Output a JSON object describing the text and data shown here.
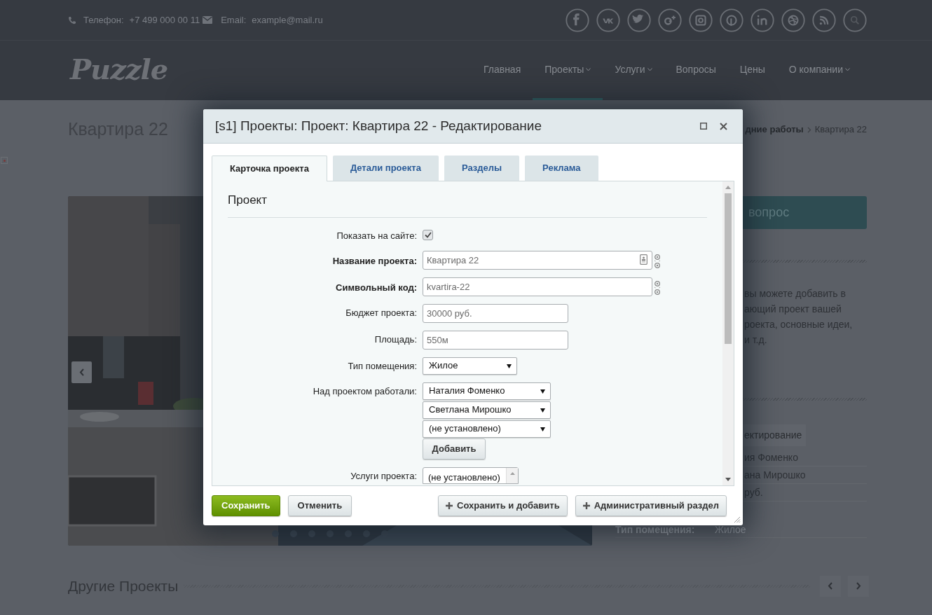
{
  "top_bar": {
    "phone_label": "Телефон:",
    "phone": "+7 499 000 00 11",
    "email_label": "Email:",
    "email": "example@mail.ru"
  },
  "logo": "Puzzle",
  "nav": [
    {
      "label": "Главная",
      "dropdown": false,
      "selected": false
    },
    {
      "label": "Проекты",
      "dropdown": true,
      "selected": true
    },
    {
      "label": "Услуги",
      "dropdown": true,
      "selected": false
    },
    {
      "label": "Вопросы",
      "dropdown": false,
      "selected": false
    },
    {
      "label": "Цены",
      "dropdown": false,
      "selected": false
    },
    {
      "label": "О компании",
      "dropdown": true,
      "selected": false
    }
  ],
  "page_title": "Квартира 22",
  "breadcrumb": [
    {
      "label": "дние работы",
      "current": false
    },
    {
      "label": "Квартира 22",
      "current": true
    }
  ],
  "sidebar": {
    "button": "вопрос",
    "text_lines": [
      "вы можете добавить в",
      "ающий проект вашей",
      "роекта, основные идеи,",
      "и т.д."
    ],
    "tag": "ектирование",
    "rows": [
      "ия Фоменко",
      "ана Мирошко",
      "руб."
    ],
    "detail_label": "Тип помещения:",
    "detail_value": "Жилое"
  },
  "other_projects": {
    "title": "Другие Проекты"
  },
  "modal": {
    "title": "[s1] Проекты: Проект: Квартира 22 - Редактирование",
    "tabs": [
      {
        "label": "Карточка проекта",
        "selected": true
      },
      {
        "label": "Детали проекта",
        "selected": false
      },
      {
        "label": "Разделы",
        "selected": false
      },
      {
        "label": "Реклама",
        "selected": false
      }
    ],
    "section": "Проект",
    "fields": [
      {
        "kind": "checkbox",
        "label": "Показать на сайте:",
        "required": false,
        "checked": true
      },
      {
        "kind": "text",
        "label": "Название проекта:",
        "required": true,
        "value": "Квартира 22",
        "inner_button": true,
        "side_button": true
      },
      {
        "kind": "text",
        "label": "Символьный код:",
        "required": true,
        "value": "kvartira-22",
        "inner_button": false,
        "side_button": true
      },
      {
        "kind": "text",
        "label": "Бюджет проекта:",
        "required": false,
        "value": "30000 руб.",
        "inner_button": false,
        "side_button": false
      },
      {
        "kind": "text",
        "label": "Площадь:",
        "required": false,
        "value": "550м",
        "inner_button": false,
        "side_button": false
      },
      {
        "kind": "select",
        "label": "Тип помещения:",
        "required": false,
        "value": "Жилое"
      },
      {
        "kind": "multi_select",
        "label": "Над проектом работали:",
        "required": false,
        "values": [
          "Наталия Фоменко",
          "Светлана Мирошко",
          "(не установлено)"
        ],
        "add_button": "Добавить"
      },
      {
        "kind": "listbox",
        "label": "Услуги проекта:",
        "required": false,
        "options": [
          "(не установлено)"
        ]
      }
    ],
    "buttons": [
      {
        "label": "Сохранить",
        "kind": "primary"
      },
      {
        "label": "Отменить",
        "kind": "plain"
      },
      {
        "label": "Сохранить и добавить",
        "kind": "add"
      },
      {
        "label": "Административный раздел",
        "kind": "add"
      }
    ]
  }
}
